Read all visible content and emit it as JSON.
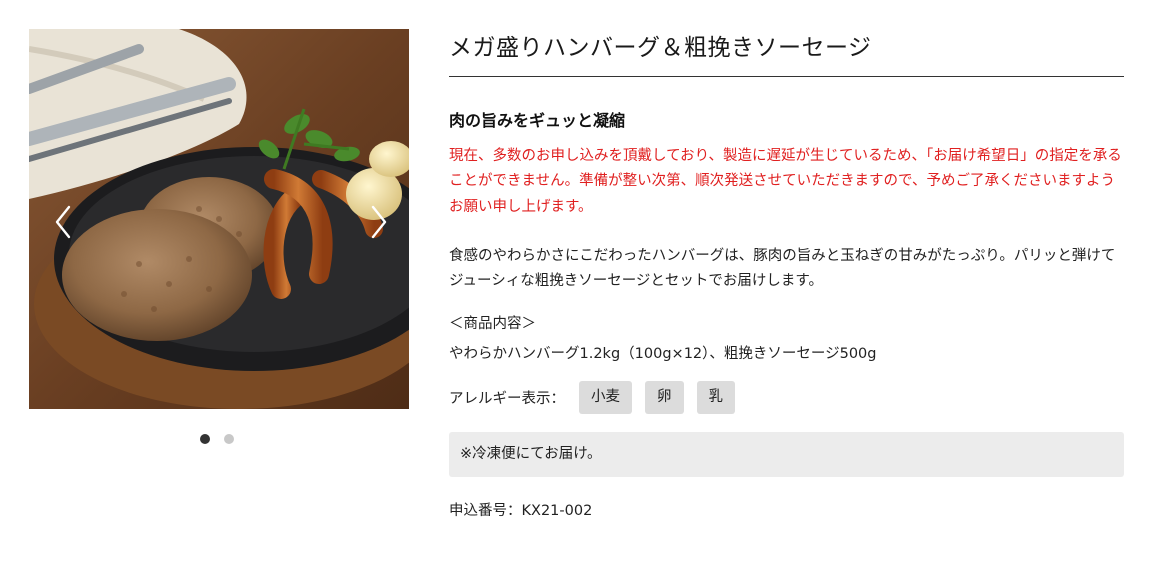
{
  "gallery": {
    "image_alt": "ハンバーグと粗挽きソーセージの写真",
    "prev_icon": "chevron-left-icon",
    "next_icon": "chevron-right-icon",
    "slide_count": 2,
    "active_slide": 1
  },
  "product": {
    "title": "メガ盛りハンバーグ＆粗挽きソーセージ",
    "subtitle": "肉の旨みをギュッと凝縮",
    "notice": "現在、多数のお申し込みを頂戴しており、製造に遅延が生じているため、「お届け希望日」の指定を承ることができません。準備が整い次第、順次発送させていただきますので、予めご了承くださいますようお願い申し上げます。",
    "description": "食感のやわらかさにこだわったハンバーグは、豚肉の旨みと玉ねぎの甘みがたっぷり。パリッと弾けてジューシィな粗挽きソーセージとセットでお届けします。",
    "contents_heading": "＜商品内容＞",
    "contents": "やわらかハンバーグ1.2kg（100g×12）、粗挽きソーセージ500g",
    "allergy_label": "アレルギー表示：",
    "allergens": [
      "小麦",
      "卵",
      "乳"
    ],
    "shipping_note": "※冷凍便にてお届け。",
    "order_number": "申込番号：KX21-002"
  },
  "colors": {
    "notice_text": "#e02020",
    "tag_background": "#dcdcdc",
    "note_background": "#ececec",
    "dot_active": "#333333",
    "dot_inactive": "#c8c8c8"
  }
}
